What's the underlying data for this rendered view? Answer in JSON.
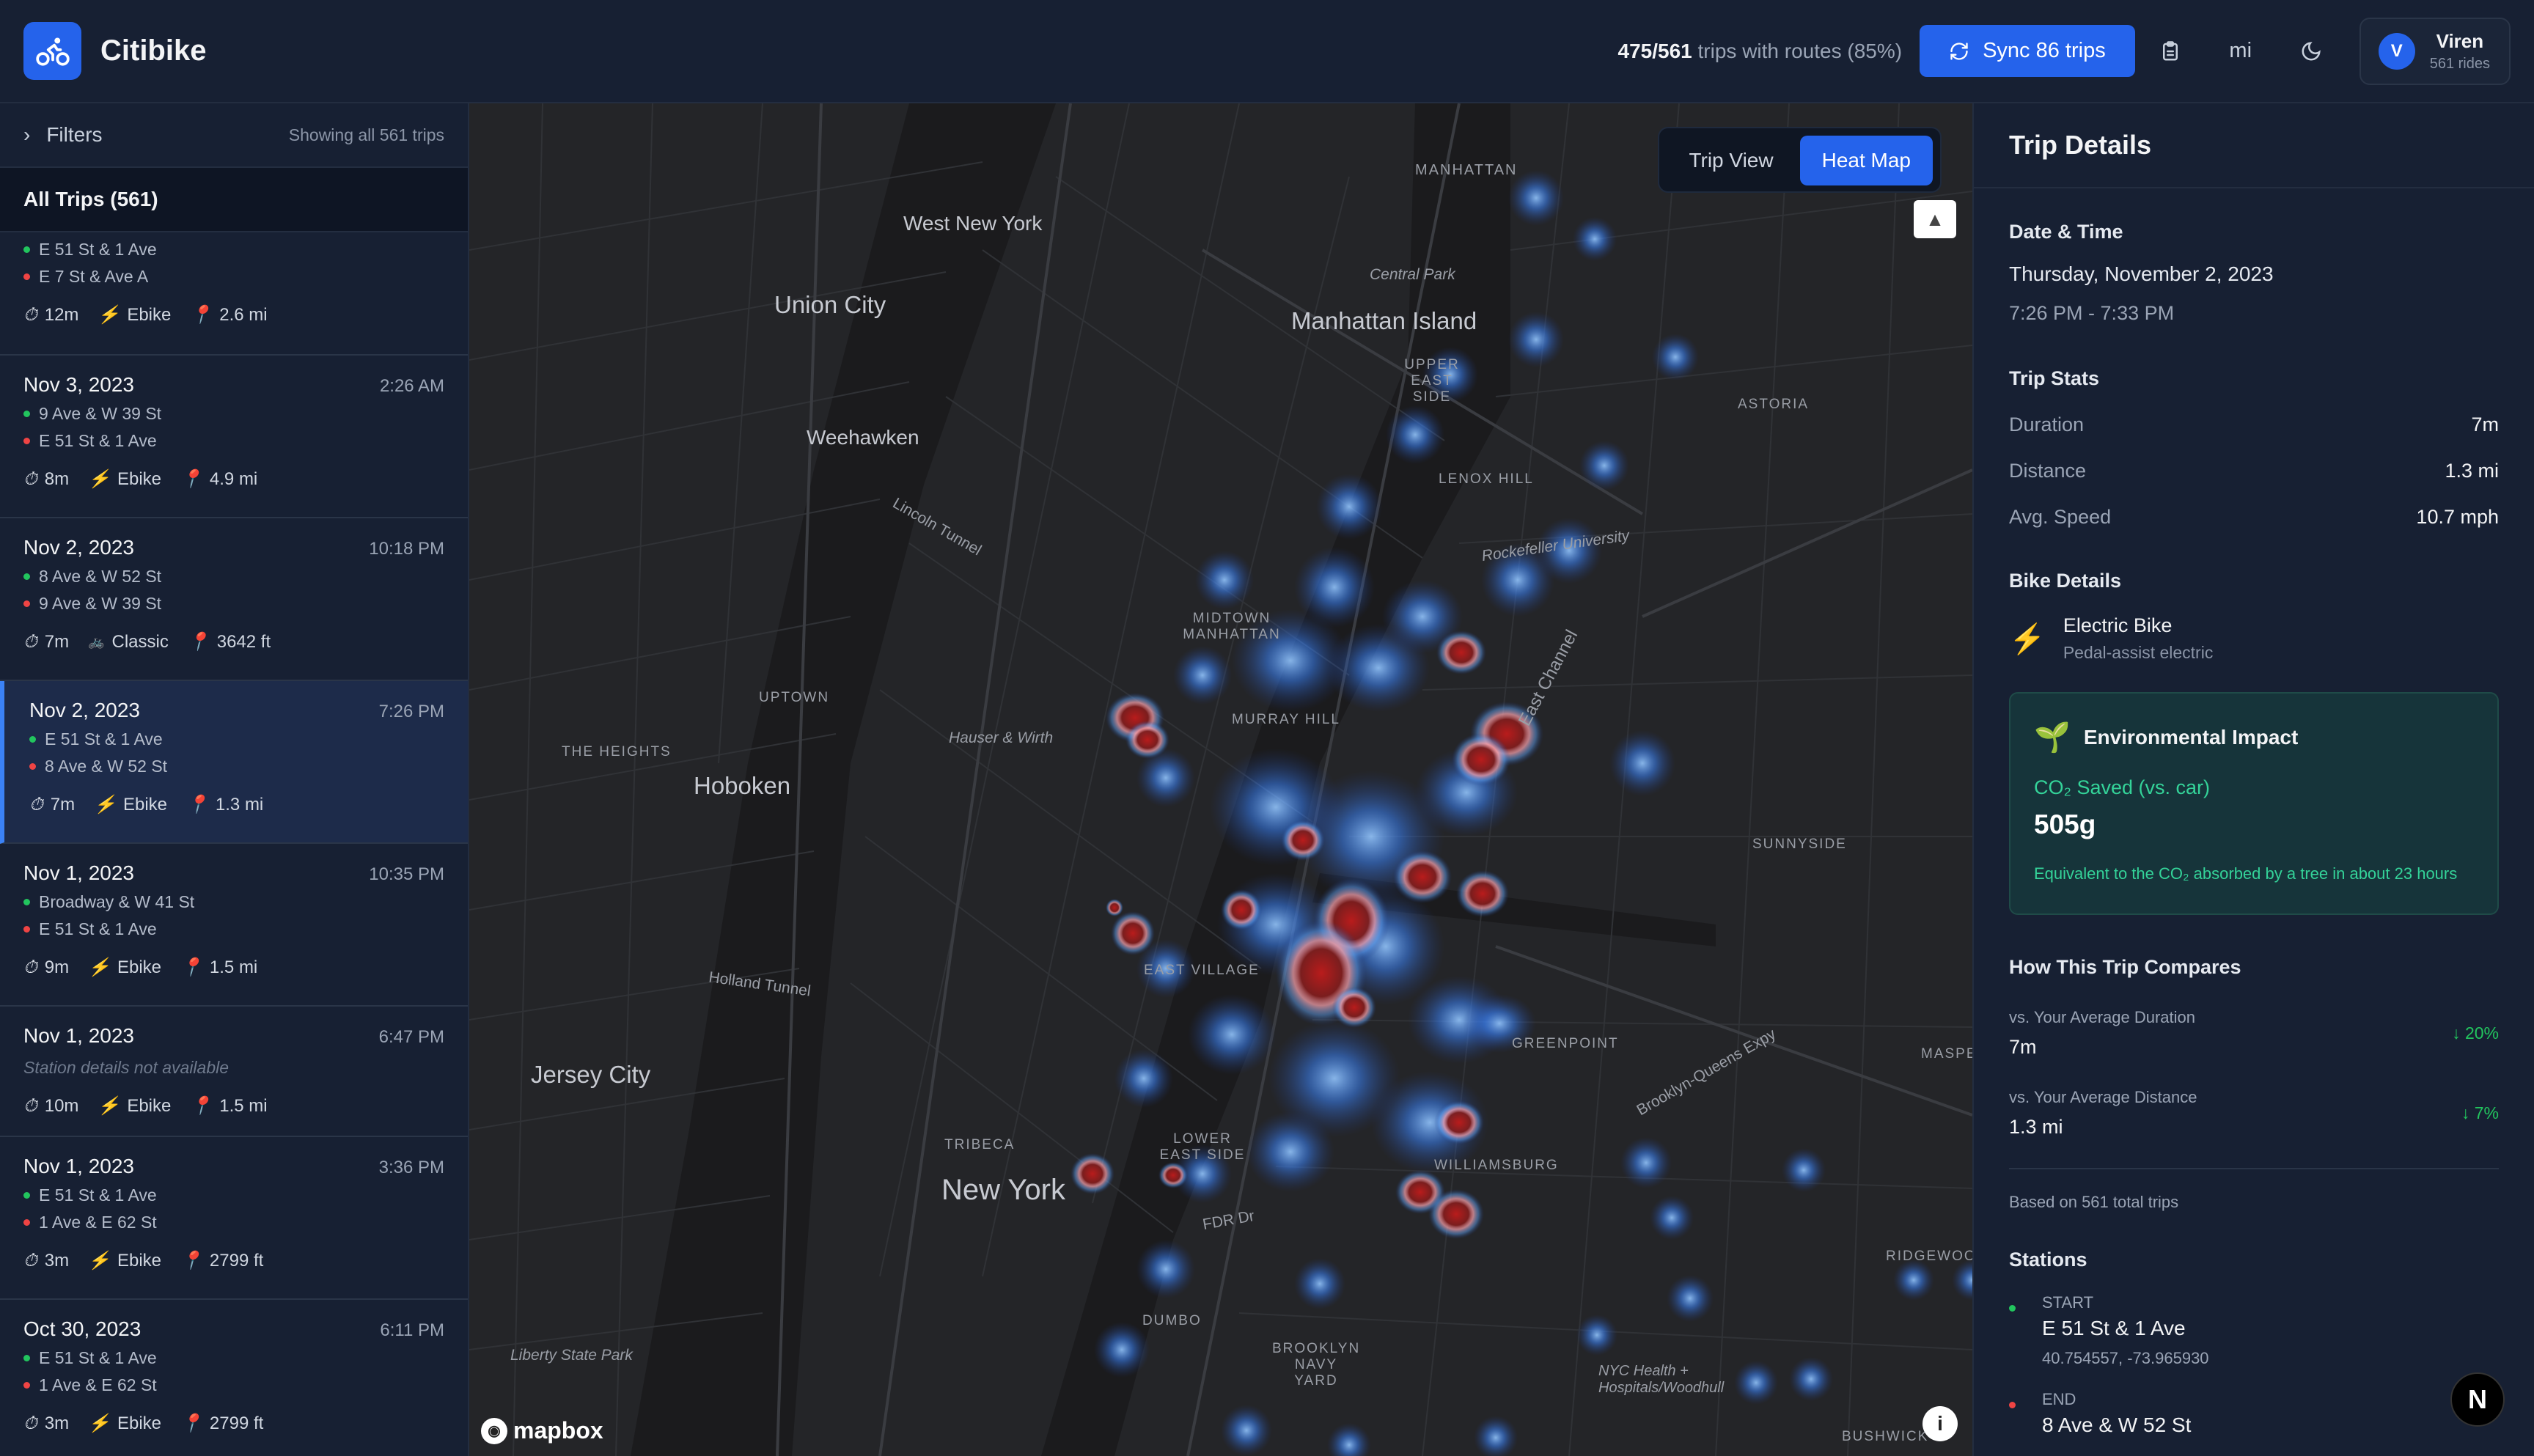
{
  "header": {
    "app_title": "Citibike",
    "routes_count": "475/561",
    "routes_text": "trips with routes (85%)",
    "sync_label": "Sync 86 trips",
    "unit_label": "mi",
    "user_initial": "V",
    "user_name": "Viren",
    "user_rides": "561 rides"
  },
  "sidebar": {
    "filters_label": "Filters",
    "showing_label": "Showing all 561 trips",
    "all_trips_label": "All Trips (561)",
    "partial_trip": {
      "start": "E 51 St & 1 Ave",
      "end": "E 7 St & Ave A",
      "duration": "12m",
      "bike": "Ebike",
      "distance": "2.6 mi"
    },
    "trips": [
      {
        "date": "Nov 3, 2023",
        "time": "2:26 AM",
        "start": "9 Ave & W 39 St",
        "end": "E 51 St & 1 Ave",
        "duration": "8m",
        "bike": "Ebike",
        "distance": "4.9 mi"
      },
      {
        "date": "Nov 2, 2023",
        "time": "10:18 PM",
        "start": "8 Ave & W 52 St",
        "end": "9 Ave & W 39 St",
        "duration": "7m",
        "bike": "Classic",
        "distance": "3642 ft"
      },
      {
        "date": "Nov 2, 2023",
        "time": "7:26 PM",
        "start": "E 51 St & 1 Ave",
        "end": "8 Ave & W 52 St",
        "duration": "7m",
        "bike": "Ebike",
        "distance": "1.3 mi"
      },
      {
        "date": "Nov 1, 2023",
        "time": "10:35 PM",
        "start": "Broadway & W 41 St",
        "end": "E 51 St & 1 Ave",
        "duration": "9m",
        "bike": "Ebike",
        "distance": "1.5 mi"
      },
      {
        "date": "Nov 1, 2023",
        "time": "6:47 PM",
        "note": "Station details not available",
        "duration": "10m",
        "bike": "Ebike",
        "distance": "1.5 mi"
      },
      {
        "date": "Nov 1, 2023",
        "time": "3:36 PM",
        "start": "E 51 St & 1 Ave",
        "end": "1 Ave & E 62 St",
        "duration": "3m",
        "bike": "Ebike",
        "distance": "2799 ft"
      },
      {
        "date": "Oct 30, 2023",
        "time": "6:11 PM",
        "start": "E 51 St & 1 Ave",
        "end": "1 Ave & E 62 St",
        "duration": "3m",
        "bike": "Ebike",
        "distance": "2799 ft"
      }
    ]
  },
  "map": {
    "view_tabs": [
      "Trip View",
      "Heat Map"
    ],
    "active_tab": "Heat Map",
    "attribution": "mapbox",
    "place_labels": [
      {
        "text": "Manhattan Island",
        "size": "large"
      },
      {
        "text": "New York",
        "size": "xlarge"
      },
      {
        "text": "Jersey City",
        "size": "large"
      },
      {
        "text": "Hoboken",
        "size": "large"
      },
      {
        "text": "Union City",
        "size": "large"
      },
      {
        "text": "Weehawken",
        "size": "medium"
      },
      {
        "text": "West New York",
        "size": "medium"
      },
      {
        "text": "MANHATTAN",
        "size": "small"
      },
      {
        "text": "UPPER EAST SIDE",
        "size": "small"
      },
      {
        "text": "MIDTOWN MANHATTAN",
        "size": "small"
      },
      {
        "text": "MURRAY HILL",
        "size": "small"
      },
      {
        "text": "EAST VILLAGE",
        "size": "small"
      },
      {
        "text": "LOWER EAST SIDE",
        "size": "small"
      },
      {
        "text": "TRIBECA",
        "size": "small"
      },
      {
        "text": "DUMBO",
        "size": "small"
      },
      {
        "text": "BROOKLYN NAVY YARD",
        "size": "small"
      },
      {
        "text": "GREENPOINT",
        "size": "small"
      },
      {
        "text": "WILLIAMSBURG",
        "size": "small"
      },
      {
        "text": "SUNNYSIDE",
        "size": "small"
      },
      {
        "text": "ASTORIA",
        "size": "small"
      },
      {
        "text": "LENOX HILL",
        "size": "small"
      },
      {
        "text": "RIDGEWOOD",
        "size": "small"
      },
      {
        "text": "BUSHWICK",
        "size": "small"
      },
      {
        "text": "UPTOWN",
        "size": "small"
      },
      {
        "text": "THE HEIGHTS",
        "size": "small"
      },
      {
        "text": "MASPETH",
        "size": "small"
      },
      {
        "text": "Central Park",
        "size": "small"
      },
      {
        "text": "Liberty State Park",
        "size": "small"
      },
      {
        "text": "Hauser & Wirth",
        "size": "small"
      },
      {
        "text": "Holland Tunnel",
        "size": "small"
      },
      {
        "text": "Lincoln Tunnel",
        "size": "small"
      },
      {
        "text": "FDR Dr",
        "size": "small"
      },
      {
        "text": "East Channel",
        "size": "small"
      },
      {
        "text": "Rockefeller University",
        "size": "small"
      },
      {
        "text": "NYC Health + Hospitals/Woodhull",
        "size": "small"
      },
      {
        "text": "Brooklyn-Queens Expy",
        "size": "small"
      }
    ]
  },
  "details": {
    "title": "Trip Details",
    "datetime_heading": "Date & Time",
    "date": "Thursday, November 2, 2023",
    "time_range": "7:26 PM - 7:33 PM",
    "stats_heading": "Trip Stats",
    "stats": [
      {
        "label": "Duration",
        "value": "7m"
      },
      {
        "label": "Distance",
        "value": "1.3 mi"
      },
      {
        "label": "Avg. Speed",
        "value": "10.7 mph"
      }
    ],
    "bike_heading": "Bike Details",
    "bike_type": "Electric Bike",
    "bike_desc": "Pedal-assist electric",
    "env_heading": "Environmental Impact",
    "co2_label": "CO₂ Saved (vs. car)",
    "co2_value": "505g",
    "co2_equiv": "Equivalent to the CO₂ absorbed by a tree in about 23 hours",
    "compare_heading": "How This Trip Compares",
    "compare": [
      {
        "label": "vs. Your Average Duration",
        "value": "7m",
        "pct": "20%"
      },
      {
        "label": "vs. Your Average Distance",
        "value": "1.3 mi",
        "pct": "7%"
      }
    ],
    "based_on": "Based on 561 total trips",
    "stations_heading": "Stations",
    "start_label": "START",
    "start_name": "E 51 St & 1 Ave",
    "start_coords": "40.754557, -73.965930",
    "end_label": "END",
    "end_name": "8 Ave & W 52 St"
  },
  "colors": {
    "accent": "#2563eb",
    "start_dot": "#22c55e",
    "end_dot": "#ef4444",
    "ebike_bolt": "#facc15"
  }
}
